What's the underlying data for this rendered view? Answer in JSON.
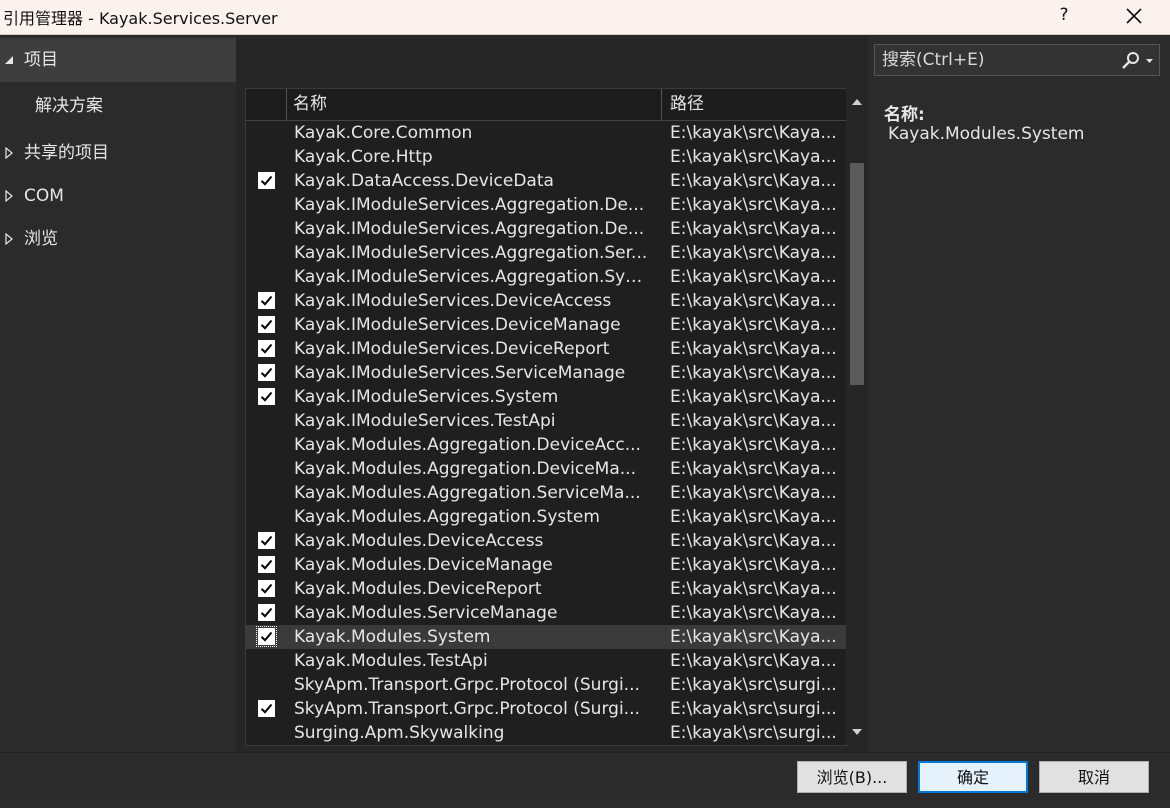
{
  "window": {
    "title": "引用管理器 - Kayak.Services.Server",
    "help": "?"
  },
  "nav": [
    {
      "label": "项目",
      "expanded": true
    },
    {
      "label": "解决方案"
    },
    {
      "label": "共享的项目",
      "expanded": false
    },
    {
      "label": "COM",
      "expanded": false
    },
    {
      "label": "浏览",
      "expanded": false
    }
  ],
  "list": {
    "header": {
      "name": "名称",
      "path": "路径"
    },
    "rows": [
      {
        "name": "Kayak.Core.Common",
        "path": "E:\\kayak\\src\\Kaya...",
        "checked": false
      },
      {
        "name": "Kayak.Core.Http",
        "path": "E:\\kayak\\src\\Kaya...",
        "checked": false
      },
      {
        "name": "Kayak.DataAccess.DeviceData",
        "path": "E:\\kayak\\src\\Kaya...",
        "checked": true
      },
      {
        "name": "Kayak.IModuleServices.Aggregation.De...",
        "path": "E:\\kayak\\src\\Kaya...",
        "checked": false
      },
      {
        "name": "Kayak.IModuleServices.Aggregation.De...",
        "path": "E:\\kayak\\src\\Kaya...",
        "checked": false
      },
      {
        "name": "Kayak.IModuleServices.Aggregation.Ser...",
        "path": "E:\\kayak\\src\\Kaya...",
        "checked": false
      },
      {
        "name": "Kayak.IModuleServices.Aggregation.Sys...",
        "path": "E:\\kayak\\src\\Kaya...",
        "checked": false
      },
      {
        "name": "Kayak.IModuleServices.DeviceAccess",
        "path": "E:\\kayak\\src\\Kaya...",
        "checked": true
      },
      {
        "name": "Kayak.IModuleServices.DeviceManage",
        "path": "E:\\kayak\\src\\Kaya...",
        "checked": true
      },
      {
        "name": "Kayak.IModuleServices.DeviceReport",
        "path": "E:\\kayak\\src\\Kaya...",
        "checked": true
      },
      {
        "name": "Kayak.IModuleServices.ServiceManage",
        "path": "E:\\kayak\\src\\Kaya...",
        "checked": true
      },
      {
        "name": "Kayak.IModuleServices.System",
        "path": "E:\\kayak\\src\\Kaya...",
        "checked": true
      },
      {
        "name": "Kayak.IModuleServices.TestApi",
        "path": "E:\\kayak\\src\\Kaya...",
        "checked": false
      },
      {
        "name": "Kayak.Modules.Aggregation.DeviceAcc...",
        "path": "E:\\kayak\\src\\Kaya...",
        "checked": false
      },
      {
        "name": "Kayak.Modules.Aggregation.DeviceMa...",
        "path": "E:\\kayak\\src\\Kaya...",
        "checked": false
      },
      {
        "name": "Kayak.Modules.Aggregation.ServiceMa...",
        "path": "E:\\kayak\\src\\Kaya...",
        "checked": false
      },
      {
        "name": "Kayak.Modules.Aggregation.System",
        "path": "E:\\kayak\\src\\Kaya...",
        "checked": false
      },
      {
        "name": "Kayak.Modules.DeviceAccess",
        "path": "E:\\kayak\\src\\Kaya...",
        "checked": true
      },
      {
        "name": "Kayak.Modules.DeviceManage",
        "path": "E:\\kayak\\src\\Kaya...",
        "checked": true
      },
      {
        "name": "Kayak.Modules.DeviceReport",
        "path": "E:\\kayak\\src\\Kaya...",
        "checked": true
      },
      {
        "name": "Kayak.Modules.ServiceManage",
        "path": "E:\\kayak\\src\\Kaya...",
        "checked": true
      },
      {
        "name": "Kayak.Modules.System",
        "path": "E:\\kayak\\src\\Kaya...",
        "checked": true,
        "selected": true
      },
      {
        "name": "Kayak.Modules.TestApi",
        "path": "E:\\kayak\\src\\Kaya...",
        "checked": false
      },
      {
        "name": "SkyApm.Transport.Grpc.Protocol (Surgi...",
        "path": "E:\\kayak\\src\\surgi...",
        "checked": false
      },
      {
        "name": "SkyApm.Transport.Grpc.Protocol (Surgi...",
        "path": "E:\\kayak\\src\\surgi...",
        "checked": true
      },
      {
        "name": "Surging.Apm.Skywalking",
        "path": "E:\\kayak\\src\\surgi...",
        "checked": false
      }
    ]
  },
  "search": {
    "placeholder": "搜索(Ctrl+E)"
  },
  "details": {
    "label": "名称:",
    "value": "Kayak.Modules.System"
  },
  "buttons": {
    "browse": "浏览(B)...",
    "ok": "确定",
    "cancel": "取消"
  },
  "colors": {
    "background": "#2b2b2b",
    "list_background": "#1f1f1f",
    "titlebar": "#fbf2ee",
    "accent": "#0078d7"
  }
}
